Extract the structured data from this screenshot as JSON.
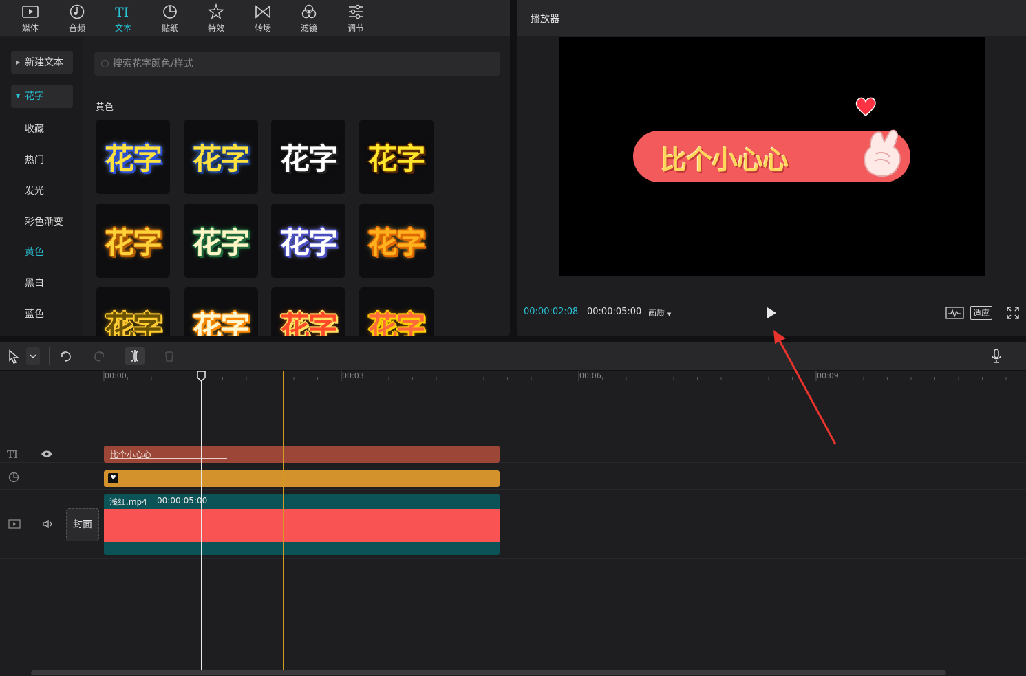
{
  "toolbar": {
    "tabs": [
      {
        "label": "媒体",
        "icon": "media-icon"
      },
      {
        "label": "音频",
        "icon": "audio-icon"
      },
      {
        "label": "文本",
        "icon": "text-icon"
      },
      {
        "label": "贴纸",
        "icon": "sticker-icon"
      },
      {
        "label": "特效",
        "icon": "effects-icon"
      },
      {
        "label": "转场",
        "icon": "transition-icon"
      },
      {
        "label": "滤镜",
        "icon": "filter-icon"
      },
      {
        "label": "调节",
        "icon": "adjust-icon"
      }
    ],
    "active_tab": "文本"
  },
  "sidebar": {
    "items": [
      {
        "label": "新建文本"
      },
      {
        "label": "花字"
      },
      {
        "label": "收藏"
      },
      {
        "label": "热门"
      },
      {
        "label": "发光"
      },
      {
        "label": "彩色渐变"
      },
      {
        "label": "黄色"
      },
      {
        "label": "黑白"
      },
      {
        "label": "蓝色"
      }
    ],
    "selected": "花字",
    "active_sub": "黄色"
  },
  "search": {
    "placeholder": "搜索花字颜色/样式"
  },
  "section": {
    "label": "黄色"
  },
  "presets": {
    "text": "花字",
    "styles": [
      {
        "fill": "#ffe23d",
        "stroke": "#2b4fd8",
        "glow": "#9ad0ff"
      },
      {
        "fill": "#ffe23d",
        "stroke": "#1b3f8a",
        "glow": "#6aa0e0"
      },
      {
        "fill": "#ffffff",
        "stroke": "#222222",
        "glow": "#000000"
      },
      {
        "fill": "#ffe62b",
        "stroke": "#5a2a00",
        "glow": "#000000"
      },
      {
        "fill": "#ffd23a",
        "stroke": "#b05a00",
        "glow": "#ff9c2a"
      },
      {
        "fill": "#fff6c8",
        "stroke": "#1f6a3a",
        "glow": "#2a8a4a"
      },
      {
        "fill": "#ffffff",
        "stroke": "#4a4fc0",
        "glow": "#9a9cf0"
      },
      {
        "fill": "#ffb21e",
        "stroke": "#e06800",
        "glow": "#ffd24a"
      },
      {
        "fill": "#6a5200",
        "stroke": "#ffcc33",
        "glow": "#ffb300"
      },
      {
        "fill": "#fff7d0",
        "stroke": "#ff8a00",
        "glow": "#ffd040"
      },
      {
        "fill": "#ff4a2a",
        "stroke": "#ffe060",
        "glow": "#ff6a00"
      },
      {
        "fill": "#ff6a3a",
        "stroke": "#ffd000",
        "glow": "#ff9000"
      }
    ]
  },
  "player": {
    "title": "播放器",
    "sticker_text": "比个小心心",
    "time_current": "00:00:02:08",
    "time_total": "00:00:05:00",
    "quality_label": "画质",
    "fit_label": "适应"
  },
  "timeline": {
    "ticks": [
      "00:00",
      "00:03",
      "00:06",
      "00:09"
    ],
    "text_clip_label": "比个小心心",
    "video_clip_name": "浅红.mp4",
    "video_clip_duration": "00:00:05:00",
    "cover_label": "封面",
    "colors": {
      "text_clip": "#9b4636",
      "sticker_clip": "#d3922b",
      "video_clip_bg": "#0b5357",
      "video_clip_fill": "#f95453"
    }
  }
}
